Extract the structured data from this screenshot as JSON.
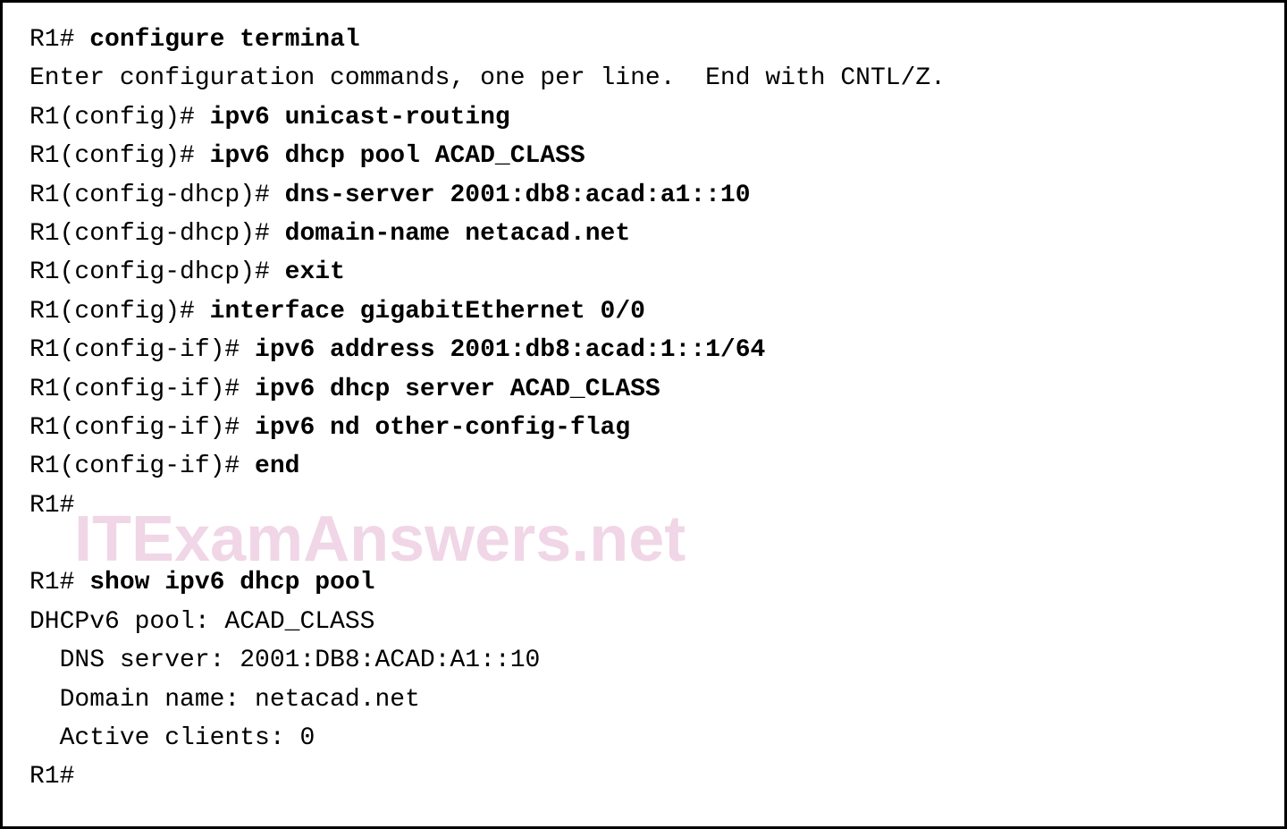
{
  "watermark": "ITExamAnswers.net",
  "lines": [
    {
      "prompt": "R1# ",
      "cmd": "configure terminal"
    },
    {
      "text": "Enter configuration commands, one per line.  End with CNTL/Z."
    },
    {
      "prompt": "R1(config)# ",
      "cmd": "ipv6 unicast-routing"
    },
    {
      "prompt": "R1(config)# ",
      "cmd": "ipv6 dhcp pool ACAD_CLASS"
    },
    {
      "prompt": "R1(config-dhcp)# ",
      "cmd": "dns-server 2001:db8:acad:a1::10"
    },
    {
      "prompt": "R1(config-dhcp)# ",
      "cmd": "domain-name netacad.net"
    },
    {
      "prompt": "R1(config-dhcp)# ",
      "cmd": "exit"
    },
    {
      "prompt": "R1(config)# ",
      "cmd": "interface gigabitEthernet 0/0"
    },
    {
      "prompt": "R1(config-if)# ",
      "cmd": "ipv6 address 2001:db8:acad:1::1/64"
    },
    {
      "prompt": "R1(config-if)# ",
      "cmd": "ipv6 dhcp server ACAD_CLASS"
    },
    {
      "prompt": "R1(config-if)# ",
      "cmd": "ipv6 nd other-config-flag"
    },
    {
      "prompt": "R1(config-if)# ",
      "cmd": "end"
    },
    {
      "prompt": "R1#",
      "cmd": ""
    },
    {
      "blank": true
    },
    {
      "prompt": "R1# ",
      "cmd": "show ipv6 dhcp pool"
    },
    {
      "text": "DHCPv6 pool: ACAD_CLASS"
    },
    {
      "text": "  DNS server: 2001:DB8:ACAD:A1::10"
    },
    {
      "text": "  Domain name: netacad.net"
    },
    {
      "text": "  Active clients: 0"
    },
    {
      "prompt": "R1#",
      "cmd": ""
    }
  ]
}
